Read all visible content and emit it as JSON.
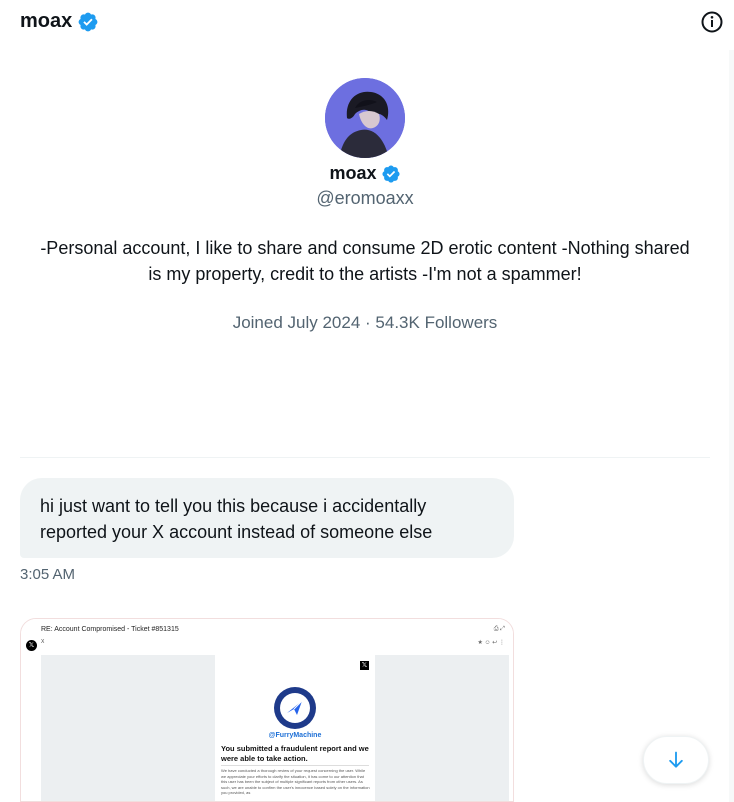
{
  "header": {
    "name": "moax",
    "verified_icon": "verified-badge-icon",
    "info_icon": "info-icon"
  },
  "profile": {
    "name": "moax",
    "handle": "@eromoaxx",
    "bio": "-Personal account, I like to share and consume 2D erotic content -Nothing shared is my property, credit to the artists -I'm not a spammer!",
    "joined": "Joined July 2024",
    "separator": "·",
    "followers": "54.3K Followers"
  },
  "message": {
    "text": "hi just want to tell you this because i accidentally reported your X account instead of someone else",
    "time": "3:05 AM"
  },
  "attachment": {
    "subject": "RE: Account Compromised - Ticket #851315",
    "sender": "X",
    "card_handle": "@FurryMachine",
    "card_title": "You submitted a fraudulent report and we were able to take action.",
    "card_text": "We have conducted a thorough review of your request concerning the user. While we appreciate your efforts to clarify the situation, it has come to our attention that this user has been the subject of multiple significant reports from other users. As such, we are unable to confirm the user's innocence based solely on the information you provided, as"
  },
  "colors": {
    "verified": "#1d9bf0",
    "muted": "#536471",
    "bubble": "#eff3f4",
    "accent": "#1d9bf0"
  },
  "scroll_button_icon": "arrow-down-icon"
}
